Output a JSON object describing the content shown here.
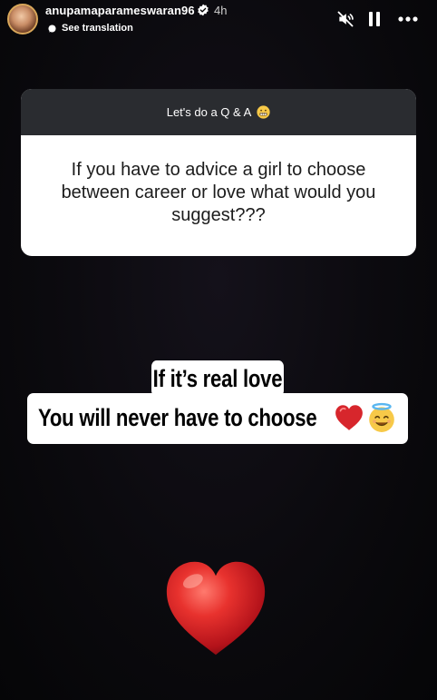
{
  "header": {
    "username": "anupamaparameswaran96",
    "time": "4h",
    "translate_label": "See translation"
  },
  "qa": {
    "prompt": "Let's do a Q & A",
    "question": "If you have to advice a girl to choose between career or love what would you suggest???"
  },
  "answer": {
    "line1": "If it’s real love",
    "line2": "You will never have to choose"
  },
  "colors": {
    "card_header": "#2a2c30",
    "verified_blue": "#3897f0",
    "heart_red": "#d7262c"
  }
}
